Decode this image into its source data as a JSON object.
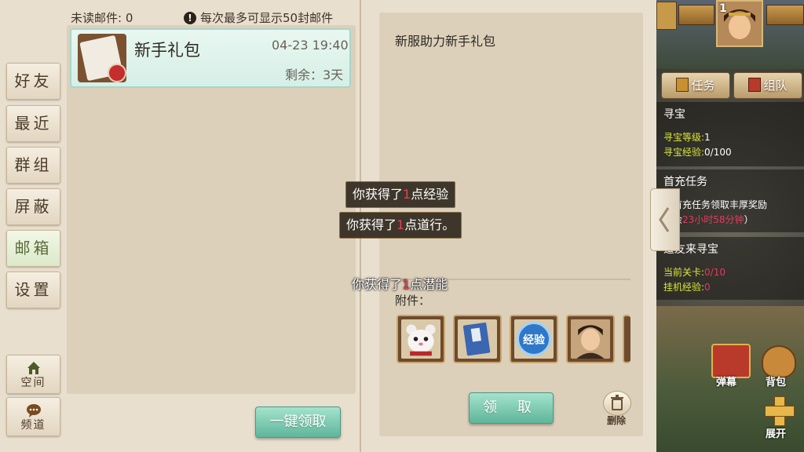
{
  "mailbox": {
    "unread_label": "未读邮件: 0",
    "limit_notice": "每次最多可显示50封邮件"
  },
  "tabs": [
    {
      "label": "好友"
    },
    {
      "label": "最近"
    },
    {
      "label": "群组"
    },
    {
      "label": "屏蔽"
    },
    {
      "label": "邮箱",
      "active": true
    },
    {
      "label": "设置"
    }
  ],
  "bottom_tabs": [
    {
      "label": "空间",
      "icon": "house-icon"
    },
    {
      "label": "频道",
      "icon": "chat-bubble-icon"
    }
  ],
  "mail_item": {
    "title": "新手礼包",
    "date": "04-23 19:40",
    "remaining": "剩余：3天"
  },
  "claim_all_label": "一键领取",
  "detail": {
    "title": "新服助力新手礼包",
    "attachments_label": "附件：",
    "attachments": [
      {
        "icon": "white-bear-pet-icon"
      },
      {
        "icon": "blue-book-icon"
      },
      {
        "icon": "experience-orb-icon",
        "text": "经验"
      },
      {
        "icon": "hero-portrait-icon"
      }
    ],
    "claim_label": "领 取",
    "delete_label": "删除"
  },
  "toasts": {
    "exp": {
      "prefix": "你获得了",
      "num": "1",
      "suffix": "点经验"
    },
    "dao": {
      "prefix": "你获得了",
      "num": "1",
      "suffix": "点道行。"
    },
    "potential": {
      "prefix": "你获得了",
      "num": "1",
      "suffix": "点潜能"
    }
  },
  "game_hud": {
    "level_badge": "1",
    "task_button": "任务",
    "team_button": "组队",
    "treasure": {
      "header": "寻宝",
      "level_label": "寻宝等级:",
      "level_value": "1",
      "exp_label": "寻宝经验:",
      "exp_value": "0/100"
    },
    "first_charge": {
      "header": "首充任务",
      "line1": "成首充任务领取丰厚奖励",
      "line2_prefix": "剩余",
      "line2_time": "23小时58分钟",
      "line2_suffix": "）"
    },
    "friends": {
      "header": "道友来寻宝",
      "stage_label": "当前关卡:",
      "stage_value": "0/10",
      "idle_label": "挂机经验:",
      "idle_value": "0"
    },
    "bottom": {
      "bomb": "弹幕",
      "bag": "背包",
      "expand": "展开"
    }
  },
  "colors": {
    "panel_bg": "#e9dfcf",
    "green_button": "#6fc3a7",
    "highlight_number": "#e0435b",
    "quest_yellow": "#d9e63c"
  }
}
